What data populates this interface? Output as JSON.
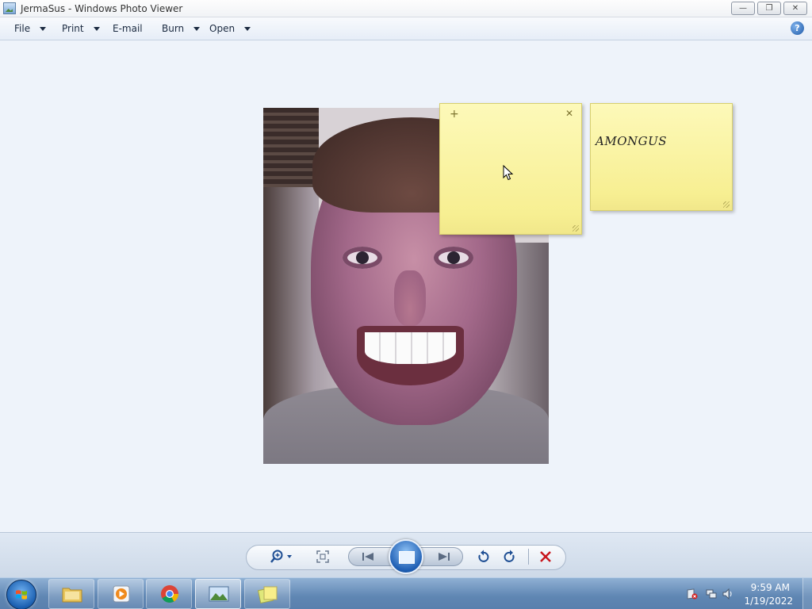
{
  "window": {
    "title": "JermaSus - Windows Photo Viewer"
  },
  "menu": {
    "file": "File",
    "print": "Print",
    "email": "E-mail",
    "burn": "Burn",
    "open": "Open",
    "help": "?"
  },
  "notes": [
    {
      "text": ""
    },
    {
      "text": "AMONGUS"
    }
  ],
  "controls": {
    "zoom": "zoom-icon",
    "actual_size": "fit-window-icon",
    "previous": "previous-icon",
    "slideshow": "slideshow-icon",
    "next": "next-icon",
    "rotate_ccw": "rotate-counterclockwise-icon",
    "rotate_cw": "rotate-clockwise-icon",
    "delete": "delete-icon"
  },
  "taskbar": {
    "apps": [
      "file-explorer",
      "media-player",
      "chrome",
      "photo-viewer",
      "sticky-notes"
    ],
    "time": "9:59 AM",
    "date": "1/19/2022"
  },
  "colors": {
    "note_yellow": "#fdf9b9",
    "viewer_bg": "#eef3fa",
    "accent_blue": "#1f4f94",
    "delete_red": "#c8161d"
  }
}
